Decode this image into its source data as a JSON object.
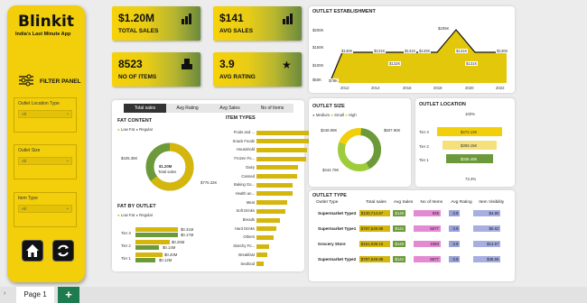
{
  "brand": {
    "name": "Blinkit",
    "tagline": "India's Last Minute App"
  },
  "filter_panel": {
    "title": "FILTER PANEL",
    "slicers": [
      {
        "label": "Outlet Location Type",
        "value": "All"
      },
      {
        "label": "Outlet Size",
        "value": "All"
      },
      {
        "label": "Item Type",
        "value": "All"
      }
    ]
  },
  "kpis": [
    {
      "value": "$1.20M",
      "label": "TOTAL SALES",
      "icon": "bar-chart-icon"
    },
    {
      "value": "$141",
      "label": "AVG SALES",
      "icon": "bar-chart-icon"
    },
    {
      "value": "8523",
      "label": "NO OF ITEMS",
      "icon": "boxes-icon"
    },
    {
      "value": "3.9",
      "label": "AVG RATING",
      "icon": "stars-icon"
    }
  ],
  "tabs": [
    "Total sales",
    "Avg Rating",
    "Avg Sales",
    "No of Items"
  ],
  "colors": {
    "gold": "#d4b60c",
    "green": "#6c9a3a",
    "yellow": "#f2cf0a",
    "lime": "#9ecc3b",
    "dark": "#333333"
  },
  "fat_content": {
    "title": "FAT CONTENT",
    "legend": [
      "Low Fat",
      "Regular"
    ],
    "center_value": "$1.20M",
    "center_label": "Total sales",
    "labels": [
      "$425.36K",
      "$776.32K"
    ]
  },
  "item_types": {
    "title": "ITEM TYPES",
    "items": [
      "Fruits and ...",
      "Snack Foods",
      "Household",
      "Frozen Fo...",
      "Dairy",
      "Canned",
      "Baking Go...",
      "Health an...",
      "Meat",
      "Soft Drinks",
      "Breads",
      "Hard Drinks",
      "Others",
      "Starchy Fo...",
      "Breakfast",
      "Seafood"
    ]
  },
  "fat_by_outlet": {
    "title": "FAT BY OUTLET",
    "legend": [
      "Low Fat",
      "Regular"
    ],
    "rows": [
      {
        "tier": "Tier 3",
        "label": "$0.31M"
      },
      {
        "tier": "Tier 2",
        "label": "$0.25M"
      },
      {
        "tier": "Tier 1",
        "label": "$0.20M"
      }
    ],
    "inner_labels": [
      "$0.17M",
      "$0.14M",
      "$0.12M"
    ]
  },
  "outlet_establishment": {
    "title": "OUTLET ESTABLISHMENT",
    "y_ticks": [
      "$200K",
      "$150K",
      "$100K",
      "$50K"
    ],
    "x_ticks": [
      "2012",
      "2014",
      "2016",
      "2018",
      "2020",
      "2022"
    ],
    "labels": [
      "$78K",
      "$130K",
      "$131K",
      "$132K",
      "$131K",
      "$133K",
      "$205K",
      "$131K",
      "$131K",
      "$130K"
    ]
  },
  "outlet_size": {
    "title": "OUTLET SIZE",
    "legend": [
      "Medium",
      "Small",
      "High"
    ],
    "labels": [
      "$248.99K",
      "$507.90K",
      "$444.79K"
    ]
  },
  "outlet_location": {
    "title": "OUTLET LOCATION",
    "top_label": "100%",
    "bottom_label": "73.3%",
    "rows": [
      {
        "tier": "Tier 3",
        "value": "$472.13K"
      },
      {
        "tier": "Tier 2",
        "value": "$393.15K"
      },
      {
        "tier": "Tier 1",
        "value": "$336.40K"
      }
    ]
  },
  "outlet_type": {
    "title": "OUTLET TYPE",
    "headers": [
      "Outlet Type",
      "Total sales",
      "Avg Sales",
      "No of Items",
      "Avg Rating",
      "Item Visibility"
    ],
    "rows": [
      [
        "Supermarket Type3",
        "$130,714.67",
        "$140",
        "935",
        "3.9",
        "$4.80"
      ],
      [
        "Supermarket Type1",
        "$787,549.89",
        "$141",
        "5577",
        "3.9",
        "$6.62"
      ],
      [
        "Grocery Store",
        "$151,939.15",
        "$140",
        "1083",
        "3.9",
        "$13.57"
      ],
      [
        "Supermarket Type2",
        "$787,549.89",
        "$141",
        "5577",
        "3.9",
        "$38.65"
      ]
    ]
  },
  "footer": {
    "page_tab": "Page 1",
    "add_label": "+"
  }
}
